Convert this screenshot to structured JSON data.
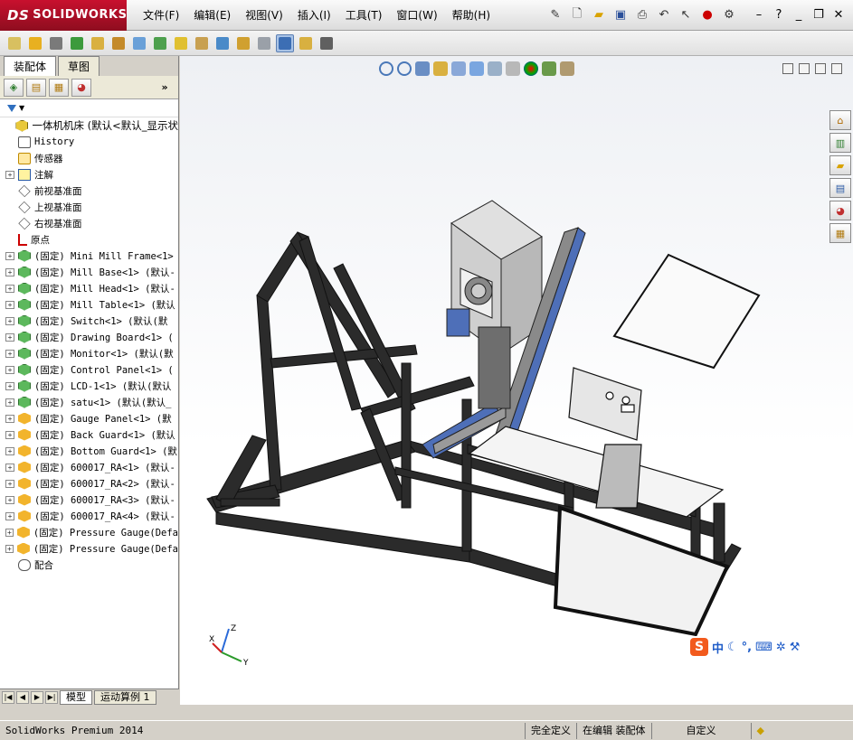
{
  "app": {
    "logo_ds": "DS",
    "logo_text": "SOLIDWORKS"
  },
  "menu": [
    "文件(F)",
    "编辑(E)",
    "视图(V)",
    "插入(I)",
    "工具(T)",
    "窗口(W)",
    "帮助(H)"
  ],
  "panel_tabs": [
    "装配体",
    "草图"
  ],
  "tree": {
    "root": "一体机机床  (默认<默认_显示状",
    "items": [
      {
        "icon": "hist",
        "label": "History",
        "expandable": false
      },
      {
        "icon": "sensor",
        "label": "传感器",
        "expandable": false
      },
      {
        "icon": "note",
        "label": "注解",
        "expandable": true
      },
      {
        "icon": "plane",
        "label": "前视基准面",
        "expandable": false
      },
      {
        "icon": "plane",
        "label": "上视基准面",
        "expandable": false
      },
      {
        "icon": "plane",
        "label": "右视基准面",
        "expandable": false
      },
      {
        "icon": "origin",
        "label": "原点",
        "expandable": false
      },
      {
        "icon": "part",
        "label": "(固定) Mini Mill Frame<1>",
        "expandable": true
      },
      {
        "icon": "part",
        "label": "(固定) Mill Base<1> (默认-",
        "expandable": true
      },
      {
        "icon": "part",
        "label": "(固定) Mill Head<1> (默认-",
        "expandable": true
      },
      {
        "icon": "part",
        "label": "(固定) Mill Table<1> (默认",
        "expandable": true
      },
      {
        "icon": "part",
        "label": "(固定) Switch<1> (默认(默",
        "expandable": true
      },
      {
        "icon": "part",
        "label": "(固定) Drawing Board<1> (",
        "expandable": true
      },
      {
        "icon": "part",
        "label": "(固定) Monitor<1> (默认(默",
        "expandable": true
      },
      {
        "icon": "part",
        "label": "(固定) Control Panel<1> (",
        "expandable": true
      },
      {
        "icon": "part",
        "label": "(固定) LCD-1<1> (默认(默认",
        "expandable": true
      },
      {
        "icon": "part",
        "label": "(固定) satu<1> (默认(默认_",
        "expandable": true
      },
      {
        "icon": "sub",
        "label": "(固定) Gauge Panel<1> (默",
        "expandable": true
      },
      {
        "icon": "sub",
        "label": "(固定) Back Guard<1> (默认",
        "expandable": true
      },
      {
        "icon": "sub",
        "label": "(固定) Bottom Guard<1> (默",
        "expandable": true
      },
      {
        "icon": "sub",
        "label": "(固定) 600017_RA<1> (默认-",
        "expandable": true
      },
      {
        "icon": "sub",
        "label": "(固定) 600017_RA<2> (默认-",
        "expandable": true
      },
      {
        "icon": "sub",
        "label": "(固定) 600017_RA<3> (默认-",
        "expandable": true
      },
      {
        "icon": "sub",
        "label": "(固定) 600017_RA<4> (默认-",
        "expandable": true
      },
      {
        "icon": "sub",
        "label": "(固定) Pressure Gauge(Defa",
        "expandable": true
      },
      {
        "icon": "sub",
        "label": "(固定) Pressure Gauge(Defa",
        "expandable": true
      },
      {
        "icon": "mate",
        "label": "配合",
        "expandable": false
      }
    ]
  },
  "bottom_tabs": [
    "模型",
    "运动算例 1"
  ],
  "ime": {
    "logo": "S",
    "mode": "中"
  },
  "triad": {
    "x": "X",
    "y": "Y",
    "z": "Z"
  },
  "status": {
    "app": "SolidWorks Premium 2014",
    "state1": "完全定义",
    "state2": "在编辑 装配体",
    "state3": "自定义"
  }
}
